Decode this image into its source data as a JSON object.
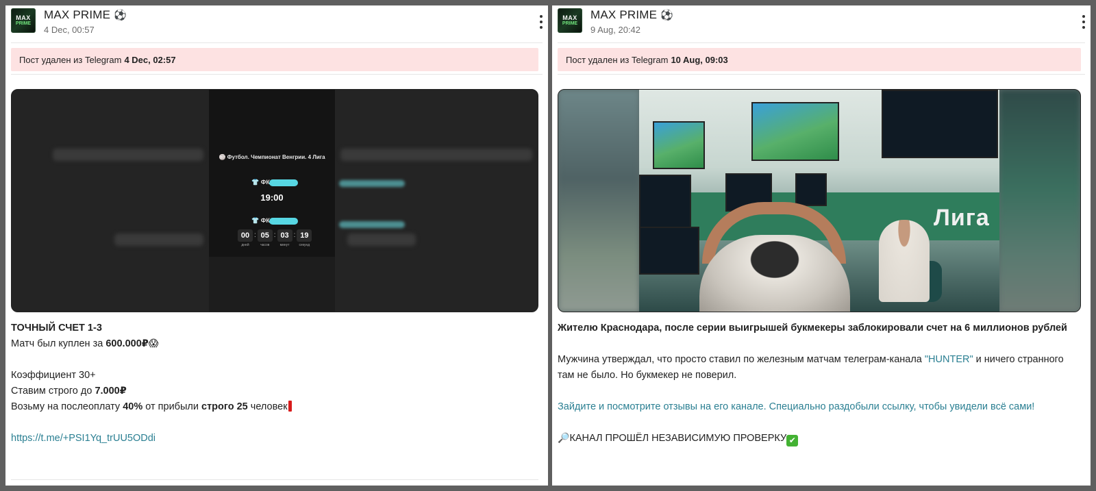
{
  "posts": [
    {
      "channel": "MAX PRIME",
      "channel_emoji": "⚽",
      "avatar_text": [
        "MAX",
        "PRIME"
      ],
      "time": "4 Dec, 00:57",
      "deleted_prefix": "Пост удален из Telegram",
      "deleted_time": "4 Dec, 02:57",
      "video": {
        "league": "🏐 Футбол. Чемпионат Венгрии. 4 Лига",
        "team_prefix": "ФК",
        "match_time": "19:00",
        "countdown": [
          {
            "value": "00",
            "label": "дней"
          },
          {
            "value": "05",
            "label": "часов"
          },
          {
            "value": "03",
            "label": "минут"
          },
          {
            "value": "19",
            "label": "секунд"
          }
        ]
      },
      "text": {
        "line1": "ТОЧНЫЙ СЧЕТ 1-3",
        "line2_prefix": "Матч был куплен за ",
        "line2_amount": "600.000₽",
        "line2_emoji": "😱",
        "line3": "Коэффициент 30+",
        "line4_prefix": "Ставим строго до ",
        "line4_amount": "7.000₽",
        "line5_a": "Возьму на послеоплату ",
        "line5_b": "40%",
        "line5_c": " от прибыли ",
        "line5_d": "строго 25",
        "line5_e": " человек",
        "link": "https://t.me/+PSI1Yq_trUU5ODdi"
      }
    },
    {
      "channel": "MAX PRIME",
      "channel_emoji": "⚽",
      "avatar_text": [
        "MAX",
        "PRIME"
      ],
      "time": "9 Aug, 20:42",
      "deleted_prefix": "Пост удален из Telegram",
      "deleted_time": "10 Aug, 09:03",
      "photo": {
        "sign": "Лига"
      },
      "text": {
        "headline": "Жителю Краснодара, после серии выигрышей букмекеры заблокировали счет на 6 миллионов рублей",
        "para_a": "Мужчина утверждал, что просто ставил по железным матчам телеграм-канала ",
        "para_link": "\"HUNTER\"",
        "para_b": " и ничего странного там не было. Но букмекер не поверил.",
        "cta": "Зайдите и посмотрите отзывы на его канале. Специально раздобыли ссылку, чтобы увидели всё сами!",
        "final_emoji": "🔎",
        "final": "КАНАЛ ПРОШЁЛ НЕЗАВИСИМУЮ ПРОВЕРКУ",
        "final_check": "✔"
      }
    }
  ]
}
